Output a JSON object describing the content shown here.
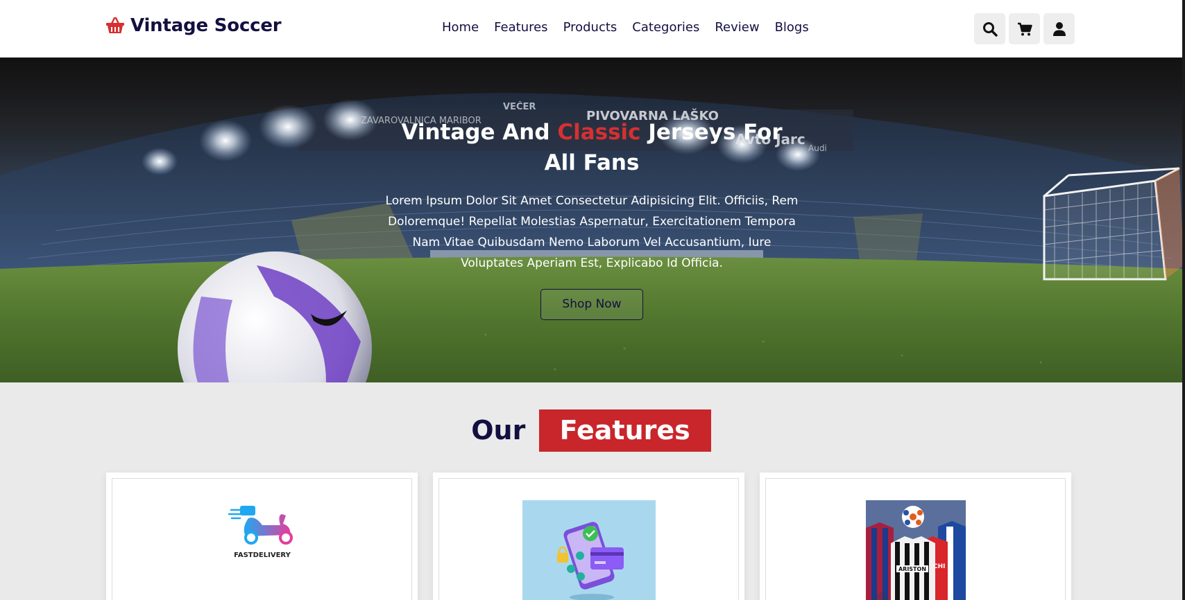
{
  "header": {
    "logo_icon": "basket-icon",
    "brand": "Vintage Soccer",
    "nav": [
      "Home",
      "Features",
      "Products",
      "Categories",
      "Review",
      "Blogs"
    ],
    "icons": [
      "search-icon",
      "cart-icon",
      "user-icon"
    ]
  },
  "hero": {
    "title_part1": "Vintage And ",
    "title_accent": "Classic",
    "title_part2": " Jerseys For All Fans",
    "text": "Lorem Ipsum Dolor Sit Amet Consectetur Adipisicing Elit. Officiis, Rem Doloremque! Repellat Molestias Aspernatur, Exercitationem Tempora Nam Vitae Quibusdam Nemo Laborum Vel Accusantium, Iure Voluptates Aperiam Est, Explicabo Id Officia.",
    "button": "Shop Now",
    "stadium_signs": [
      "ZAVAROVALNICA MARIBOR",
      "VEČER",
      "PIVOVARNA LAŠKO",
      "Avto Jarc",
      "Audi"
    ]
  },
  "features": {
    "heading": "Our",
    "heading_tag": "Features",
    "cards": [
      {
        "image": "fast-delivery-image",
        "image_text": "FASTDELIVERY"
      },
      {
        "image": "secure-payment-image"
      },
      {
        "image": "jerseys-image"
      }
    ]
  },
  "colors": {
    "brand": "#130f40",
    "accent": "#d63031",
    "tag_bg": "#c8262b"
  }
}
